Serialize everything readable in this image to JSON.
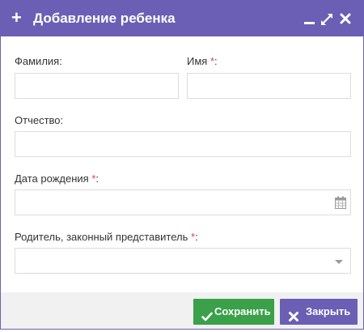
{
  "dialog": {
    "title": "Добавление ребенка",
    "controls": {
      "minimize": "minimize-icon",
      "maximize": "expand-icon",
      "close": "close-icon"
    }
  },
  "form": {
    "last_name": {
      "label": "Фамилия:",
      "value": ""
    },
    "first_name": {
      "label": "Имя ",
      "required_mark": "*",
      "label_suffix": ":",
      "value": ""
    },
    "middle_name": {
      "label": "Отчество:",
      "value": ""
    },
    "birth_date": {
      "label": "Дата рождения ",
      "required_mark": "*",
      "label_suffix": ":",
      "value": "",
      "icon": "calendar-icon"
    },
    "parent": {
      "label": "Родитель, законный представитель ",
      "required_mark": "*",
      "label_suffix": ":",
      "selected": ""
    }
  },
  "footer": {
    "save_label": "Сохранить",
    "close_label": "Закрыть"
  },
  "colors": {
    "header": "#6a5fb4",
    "save_button": "#3aa04a",
    "close_button": "#6a5fb4",
    "required": "#e04040"
  }
}
